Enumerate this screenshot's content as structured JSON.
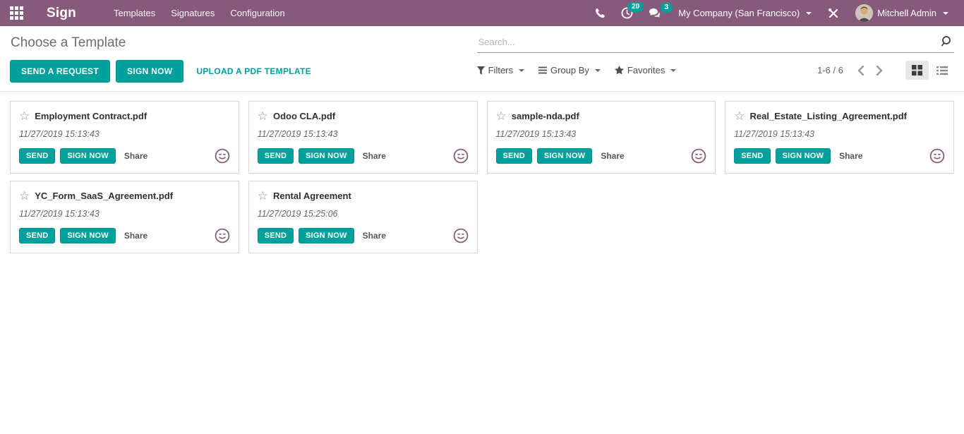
{
  "topbar": {
    "app_name": "Sign",
    "menu_items": [
      {
        "label": "Templates"
      },
      {
        "label": "Signatures"
      },
      {
        "label": "Configuration"
      }
    ],
    "systray": {
      "activities_count": "20",
      "messages_count": "3",
      "company": "My Company (San Francisco)",
      "user": "Mitchell Admin"
    }
  },
  "control_panel": {
    "title": "Choose a Template",
    "send_request_label": "SEND A REQUEST",
    "sign_now_label": "SIGN NOW",
    "upload_label": "UPLOAD A PDF TEMPLATE",
    "search": {
      "placeholder": "Search..."
    },
    "filters_label": "Filters",
    "group_by_label": "Group By",
    "favorites_label": "Favorites",
    "pager_text": "1-6 / 6"
  },
  "kanban": {
    "actions": {
      "send": "SEND",
      "sign_now": "SIGN NOW",
      "share": "Share"
    },
    "cards": [
      {
        "title": "Employment Contract.pdf",
        "datetime": "11/27/2019 15:13:43"
      },
      {
        "title": "Odoo CLA.pdf",
        "datetime": "11/27/2019 15:13:43"
      },
      {
        "title": "sample-nda.pdf",
        "datetime": "11/27/2019 15:13:43"
      },
      {
        "title": "Real_Estate_Listing_Agreement.pdf",
        "datetime": "11/27/2019 15:13:43"
      },
      {
        "title": "YC_Form_SaaS_Agreement.pdf",
        "datetime": "11/27/2019 15:13:43"
      },
      {
        "title": "Rental Agreement",
        "datetime": "11/27/2019 15:25:06"
      }
    ]
  },
  "colors": {
    "primary": "#875A7B",
    "accent": "#00A09D"
  }
}
